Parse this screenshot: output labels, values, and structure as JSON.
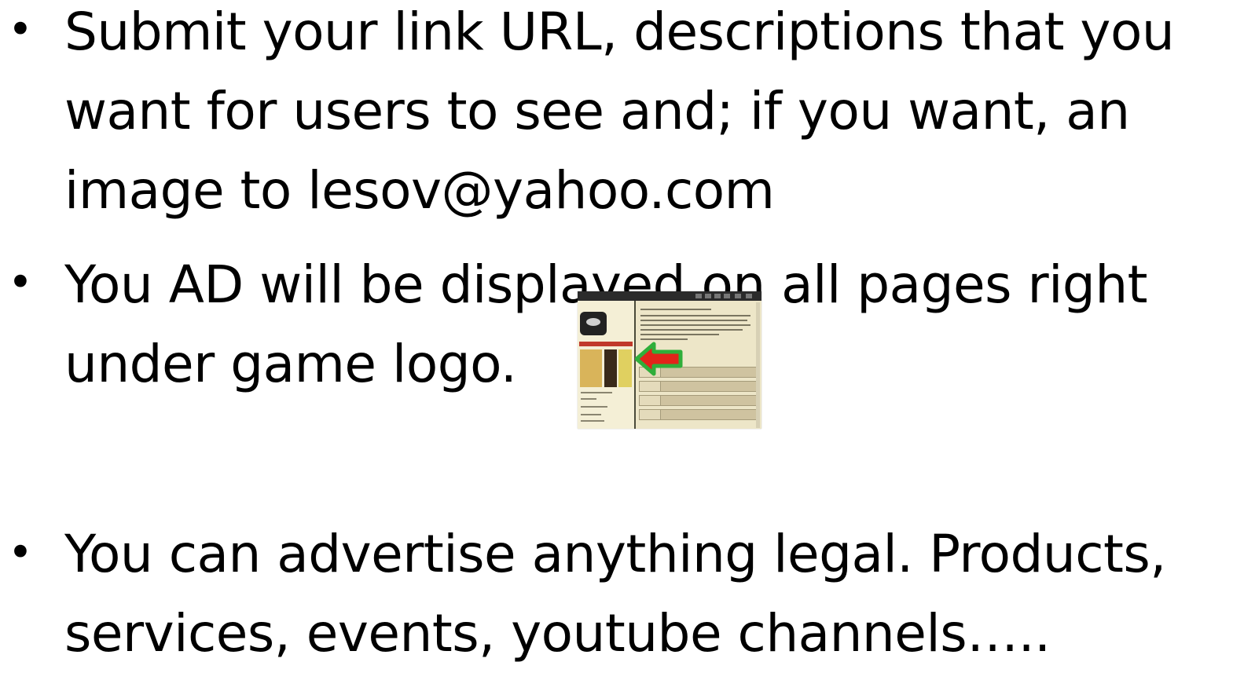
{
  "bullets": [
    {
      "marker": "•",
      "lines": [
        "Submit your link URL, descriptions that you",
        "want for users to see and; if you want, an",
        "image to lesov@yahoo.com"
      ]
    },
    {
      "marker": "•",
      "lines": [
        "You AD will be displayed on all pages right",
        "under game logo."
      ]
    },
    {
      "marker": "•",
      "lines": [
        "You can advertise anything legal. Products,",
        "services, events, youtube channels….."
      ]
    }
  ],
  "thumbnail": {
    "description_icon": "website-screenshot-image",
    "arrow_icon": "left-arrow-icon",
    "arrow_fill": "#e2231a",
    "arrow_outline": "#2fae3a"
  }
}
